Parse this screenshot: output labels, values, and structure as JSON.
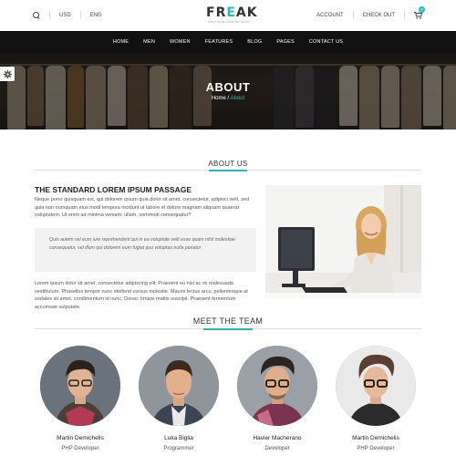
{
  "topbar": {
    "currency": "USD",
    "language": "ENG",
    "account_label": "ACCOUNT",
    "checkout_label": "CHECK OUT",
    "cart_count": "0"
  },
  "logo": {
    "name_pre": "FR",
    "name_accent": "E",
    "name_post": "AK",
    "tagline": "BOUTIQUE FASHION SHOP"
  },
  "nav": [
    "HOME",
    "MEN",
    "WOMEN",
    "FEATURES",
    "BLOG",
    "PAGES",
    "CONTACT US"
  ],
  "hero": {
    "title": "ABOUT",
    "crumb_home": "Home",
    "crumb_sep": " / ",
    "crumb_current": "About"
  },
  "about": {
    "section_title": "ABOUT US",
    "heading": "THE STANDARD LOREM IPSUM PASSAGE",
    "para1": "Neque porro quisquam est, qui dolorem ipsum quia dolor sit amet, consectetur, adipisci velit, sed quia non numquam eius modi tempora incidunt ut labore et dolore magnam aliquam quaerat voluptatem. Ut enim ad minima veniam, ullam, commodi consequatur?",
    "quote": "Quis autem vel eum iure reprehenderit qui in ea voluptate velit esse quam nihil molestiae consequatur, vel illum qui dolorem eum fugiat quo voluptas nulla pariatur",
    "para2": "Lorem ipsum dolor sit amet, consectetur adipiscing elit. Praesent eu nisl ac mi malesuada vestibulum. Phasellus tempor nunc eleifend cursus molestie. Mauris lectus arcu, pellentesque at sodales sit amet, condimentum id nunc. Donec ornare mattis suscipit. Praesent fermentum accumsan vulputate."
  },
  "team": {
    "section_title": "MEET THE TEAM",
    "members": [
      {
        "name": "Martin Demichelis",
        "role": "PHP Developer"
      },
      {
        "name": "Luka Biglia",
        "role": "Programmer"
      },
      {
        "name": "Havier Macherano",
        "role": "Developer"
      },
      {
        "name": "Martin Demichelis",
        "role": "PHP Developer"
      }
    ]
  },
  "colors": {
    "accent": "#26b9c0",
    "nav_bg": "#111111"
  }
}
